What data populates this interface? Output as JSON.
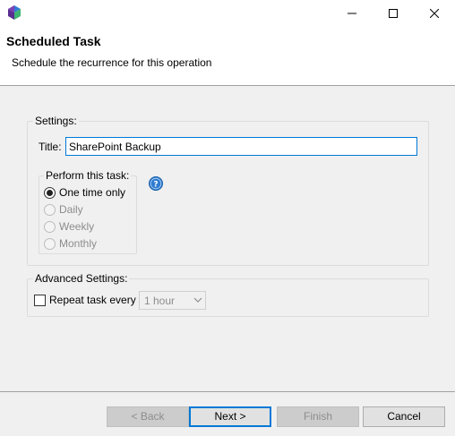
{
  "window": {
    "title": "Scheduled Task",
    "subtitle": "Schedule the recurrence for this operation"
  },
  "settings": {
    "legend": "Settings:",
    "title_label": "Title:",
    "title_value": "SharePoint Backup",
    "perform": {
      "legend": "Perform this task:",
      "options": [
        {
          "label": "One time only",
          "checked": true,
          "enabled": true
        },
        {
          "label": "Daily",
          "checked": false,
          "enabled": false
        },
        {
          "label": "Weekly",
          "checked": false,
          "enabled": false
        },
        {
          "label": "Monthly",
          "checked": false,
          "enabled": false
        }
      ]
    }
  },
  "advanced": {
    "legend": "Advanced Settings:",
    "repeat_label": "Repeat task every",
    "repeat_checked": false,
    "interval_value": "1 hour"
  },
  "buttons": {
    "back": "< Back",
    "next": "Next >",
    "finish": "Finish",
    "cancel": "Cancel"
  },
  "icons": {
    "app": "app-logo-icon",
    "help": "help-icon",
    "minimize": "minimize-icon",
    "maximize": "maximize-icon",
    "close": "close-icon"
  },
  "colors": {
    "accent": "#0078d7",
    "help_blue": "#2f7cd1"
  }
}
